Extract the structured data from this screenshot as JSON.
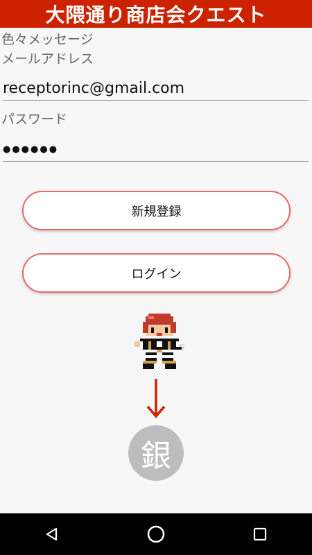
{
  "header": {
    "title": "大隈通り商店会クエスト"
  },
  "form": {
    "message": "色々メッセージ",
    "email_label": "メールアドレス",
    "email_value": "receptorinc@gmail.com",
    "password_label": "パスワード",
    "password_value": "●●●●●●"
  },
  "buttons": {
    "register": "新規登録",
    "login": "ログイン"
  },
  "badge": {
    "text": "銀"
  },
  "navbar": {
    "icons": [
      "back-icon",
      "home-icon",
      "recents-icon"
    ]
  },
  "colors": {
    "accent": "#cc2200",
    "button_border": "#e76a6a",
    "arrow": "#cc2200",
    "badge": "#bdbdbd"
  }
}
